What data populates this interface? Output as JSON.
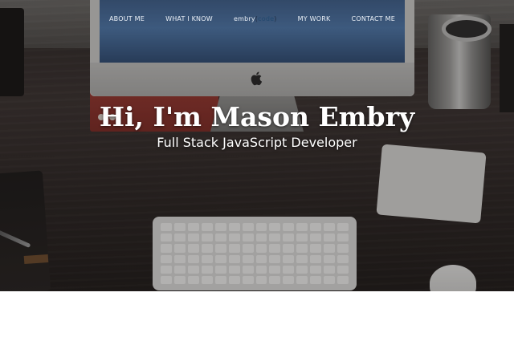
{
  "nav": {
    "left": [
      {
        "label": "ABOUT ME"
      },
      {
        "label": "WHAT I KNOW"
      }
    ],
    "brand": {
      "name": "embry",
      "open": "(",
      "accent": "code",
      "close": ")"
    },
    "right": [
      {
        "label": "MY WORK"
      },
      {
        "label": "CONTACT ME"
      }
    ]
  },
  "hero": {
    "title": "Hi, I'm Mason Embry",
    "subtitle": "Full Stack JavaScript Developer",
    "icon": "apple-logo-icon"
  },
  "colors": {
    "text": "#ffffff",
    "brand": "#1f2f43",
    "brand_accent": "#22496f",
    "screen": "#4d76a8",
    "page_bg": "#ffffff"
  }
}
